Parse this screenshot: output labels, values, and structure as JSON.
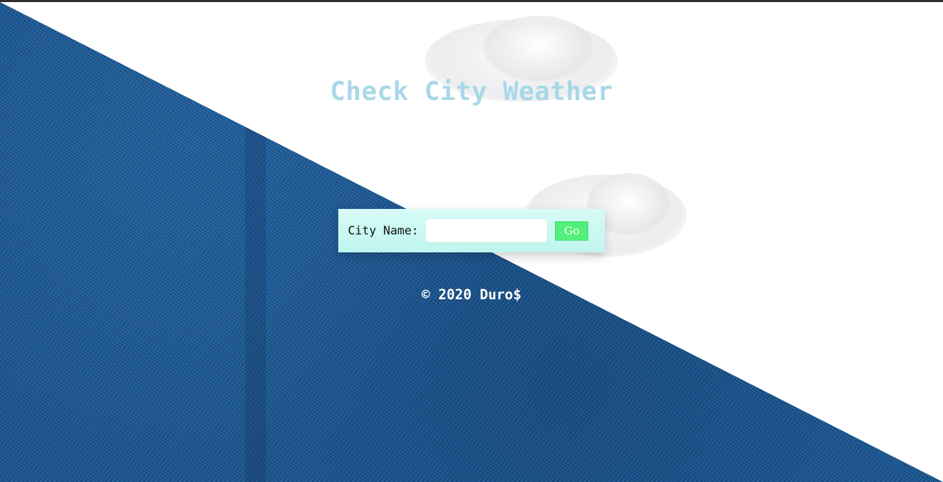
{
  "header": {
    "title": "Check City Weather"
  },
  "form": {
    "label": "City Name:",
    "input_value": "",
    "input_placeholder": "",
    "go_label": "Go"
  },
  "footer": {
    "text": "© 2020 Duro$"
  },
  "colors": {
    "title": "#a8d8e8",
    "turf": "#1f5f9a",
    "form_background": "#c8f7f0",
    "go_button": "#52f07a"
  }
}
